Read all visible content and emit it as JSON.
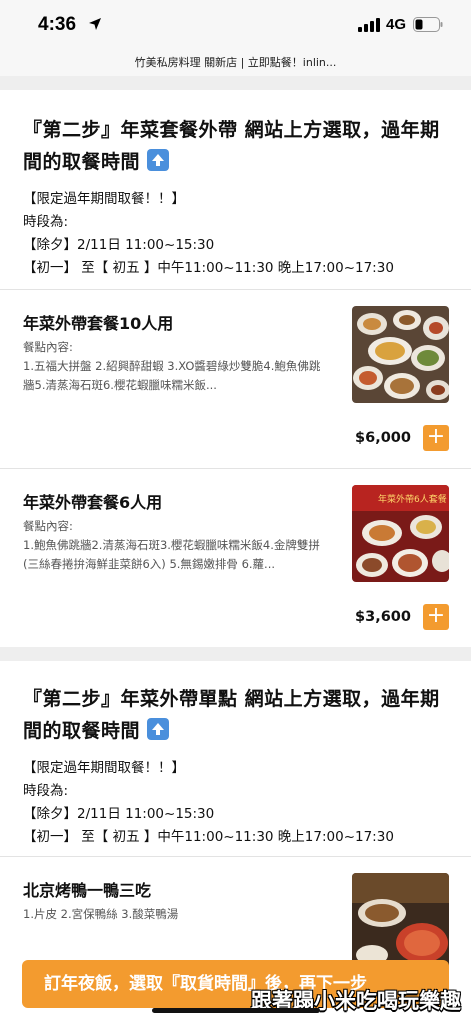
{
  "status_bar": {
    "time": "4:36",
    "network": "4G"
  },
  "page_title": "竹美私房料理 關新店 | 立即點餐！inlin...",
  "sections": [
    {
      "title": "『第二步』年菜套餐外帶 網站上方選取，過年期間的取餐時間",
      "notice": "【限定過年期間取餐！！】",
      "time_label": "時段為:",
      "line1": "【除夕】2/11日 11:00~15:30",
      "line2": "【初一】 至【 初五 】中午11:00~11:30 晚上17:00~17:30"
    },
    {
      "title": "『第二步』年菜外帶單點 網站上方選取，過年期間的取餐時間",
      "notice": "【限定過年期間取餐！！】",
      "time_label": "時段為:",
      "line1": "【除夕】2/11日 11:00~15:30",
      "line2": "【初一】 至【 初五 】中午11:00~11:30 晚上17:00~17:30"
    }
  ],
  "products": [
    {
      "name": "年菜外帶套餐10人用",
      "desc_label": "餐點內容:",
      "desc": "1.五福大拼盤 2.紹興醉甜蝦 3.XO醬碧綠炒雙脆4.鮑魚佛跳牆5.清蒸海石斑6.櫻花蝦臘味糯米飯...",
      "price": "$6,000",
      "add": "+"
    },
    {
      "name": "年菜外帶套餐6人用",
      "desc_label": "餐點內容:",
      "desc": "1.鮑魚佛跳牆2.清蒸海石斑3.櫻花蝦臘味糯米飯4.金牌雙拼(三絲春捲拚海鮮韭菜餅6入) 5.無錫嫩排骨 6.蘿...",
      "price": "$3,600",
      "add": "+",
      "image_text": "年菜外帶6人套餐"
    },
    {
      "name": "北京烤鴨一鴨三吃",
      "desc": "1.片皮 2.宮保鴨絲 3.酸菜鴨湯"
    }
  ],
  "cta_label": "訂年夜飯，選取『取貨時間』後，再下一步",
  "watermark": "跟著蹋小米吃喝玩樂趣",
  "colors": {
    "accent": "#f39b2f",
    "badge_blue": "#4a8fdc"
  }
}
